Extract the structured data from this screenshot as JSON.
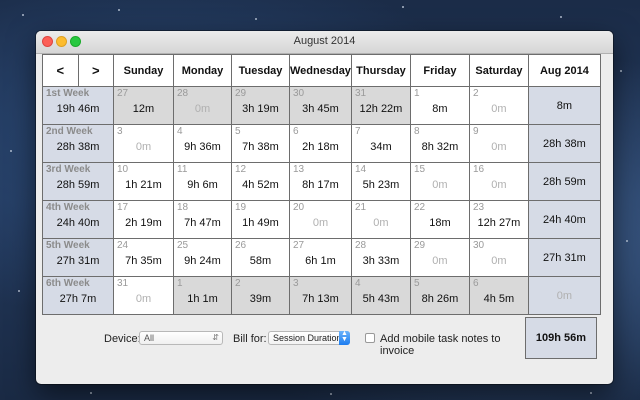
{
  "window": {
    "title": "August 2014"
  },
  "nav": {
    "prev_label": "<",
    "next_label": ">"
  },
  "headers": [
    "Sunday",
    "Monday",
    "Tuesday",
    "Wednesday",
    "Thursday",
    "Friday",
    "Saturday"
  ],
  "month_header": "Aug 2014",
  "weeks": [
    {
      "label": "1st Week",
      "total": "19h 46m",
      "month_total": "8m",
      "days": [
        {
          "num": "27",
          "value": "12m",
          "outside": true
        },
        {
          "num": "28",
          "value": "0m",
          "outside": true
        },
        {
          "num": "29",
          "value": "3h 19m",
          "outside": true
        },
        {
          "num": "30",
          "value": "3h 45m",
          "outside": true
        },
        {
          "num": "31",
          "value": "12h 22m",
          "outside": true
        },
        {
          "num": "1",
          "value": "8m",
          "outside": false
        },
        {
          "num": "2",
          "value": "0m",
          "outside": false
        }
      ]
    },
    {
      "label": "2nd Week",
      "total": "28h 38m",
      "month_total": "28h 38m",
      "days": [
        {
          "num": "3",
          "value": "0m",
          "outside": false
        },
        {
          "num": "4",
          "value": "9h 36m",
          "outside": false
        },
        {
          "num": "5",
          "value": "7h 38m",
          "outside": false
        },
        {
          "num": "6",
          "value": "2h 18m",
          "outside": false
        },
        {
          "num": "7",
          "value": "34m",
          "outside": false
        },
        {
          "num": "8",
          "value": "8h 32m",
          "outside": false
        },
        {
          "num": "9",
          "value": "0m",
          "outside": false
        }
      ]
    },
    {
      "label": "3rd Week",
      "total": "28h 59m",
      "month_total": "28h 59m",
      "days": [
        {
          "num": "10",
          "value": "1h 21m",
          "outside": false
        },
        {
          "num": "11",
          "value": "9h 6m",
          "outside": false
        },
        {
          "num": "12",
          "value": "4h 52m",
          "outside": false
        },
        {
          "num": "13",
          "value": "8h 17m",
          "outside": false
        },
        {
          "num": "14",
          "value": "5h 23m",
          "outside": false
        },
        {
          "num": "15",
          "value": "0m",
          "outside": false
        },
        {
          "num": "16",
          "value": "0m",
          "outside": false
        }
      ]
    },
    {
      "label": "4th Week",
      "total": "24h 40m",
      "month_total": "24h 40m",
      "days": [
        {
          "num": "17",
          "value": "2h 19m",
          "outside": false
        },
        {
          "num": "18",
          "value": "7h 47m",
          "outside": false
        },
        {
          "num": "19",
          "value": "1h 49m",
          "outside": false
        },
        {
          "num": "20",
          "value": "0m",
          "outside": false
        },
        {
          "num": "21",
          "value": "0m",
          "outside": false
        },
        {
          "num": "22",
          "value": "18m",
          "outside": false
        },
        {
          "num": "23",
          "value": "12h 27m",
          "outside": false
        }
      ]
    },
    {
      "label": "5th Week",
      "total": "27h 31m",
      "month_total": "27h 31m",
      "days": [
        {
          "num": "24",
          "value": "7h 35m",
          "outside": false
        },
        {
          "num": "25",
          "value": "9h 24m",
          "outside": false
        },
        {
          "num": "26",
          "value": "58m",
          "outside": false
        },
        {
          "num": "27",
          "value": "6h 1m",
          "outside": false
        },
        {
          "num": "28",
          "value": "3h 33m",
          "outside": false
        },
        {
          "num": "29",
          "value": "0m",
          "outside": false
        },
        {
          "num": "30",
          "value": "0m",
          "outside": false
        }
      ]
    },
    {
      "label": "6th Week",
      "total": "27h 7m",
      "month_total": "0m",
      "days": [
        {
          "num": "31",
          "value": "0m",
          "outside": false
        },
        {
          "num": "1",
          "value": "1h 1m",
          "outside": true
        },
        {
          "num": "2",
          "value": "39m",
          "outside": true
        },
        {
          "num": "3",
          "value": "7h 13m",
          "outside": true
        },
        {
          "num": "4",
          "value": "5h 43m",
          "outside": true
        },
        {
          "num": "5",
          "value": "8h 26m",
          "outside": true
        },
        {
          "num": "6",
          "value": "4h 5m",
          "outside": true
        }
      ]
    }
  ],
  "footer": {
    "device_label": "Device:",
    "device_value": "All",
    "bill_label": "Bill for:",
    "bill_value": "Session Duration",
    "mobile_notes_label": "Add mobile task notes to invoice",
    "grand_total": "109h 56m"
  },
  "icons": {
    "select_chevron": "updown-chevron-icon",
    "stepper": "stepper-arrows-icon"
  },
  "colors": {
    "week_cell": "#d6dbe6",
    "outside_day": "#d9d9d9",
    "close": "#fc5f57",
    "minimize": "#fdbc2e",
    "maximize": "#28c840",
    "accent": "#1c7cf0"
  }
}
